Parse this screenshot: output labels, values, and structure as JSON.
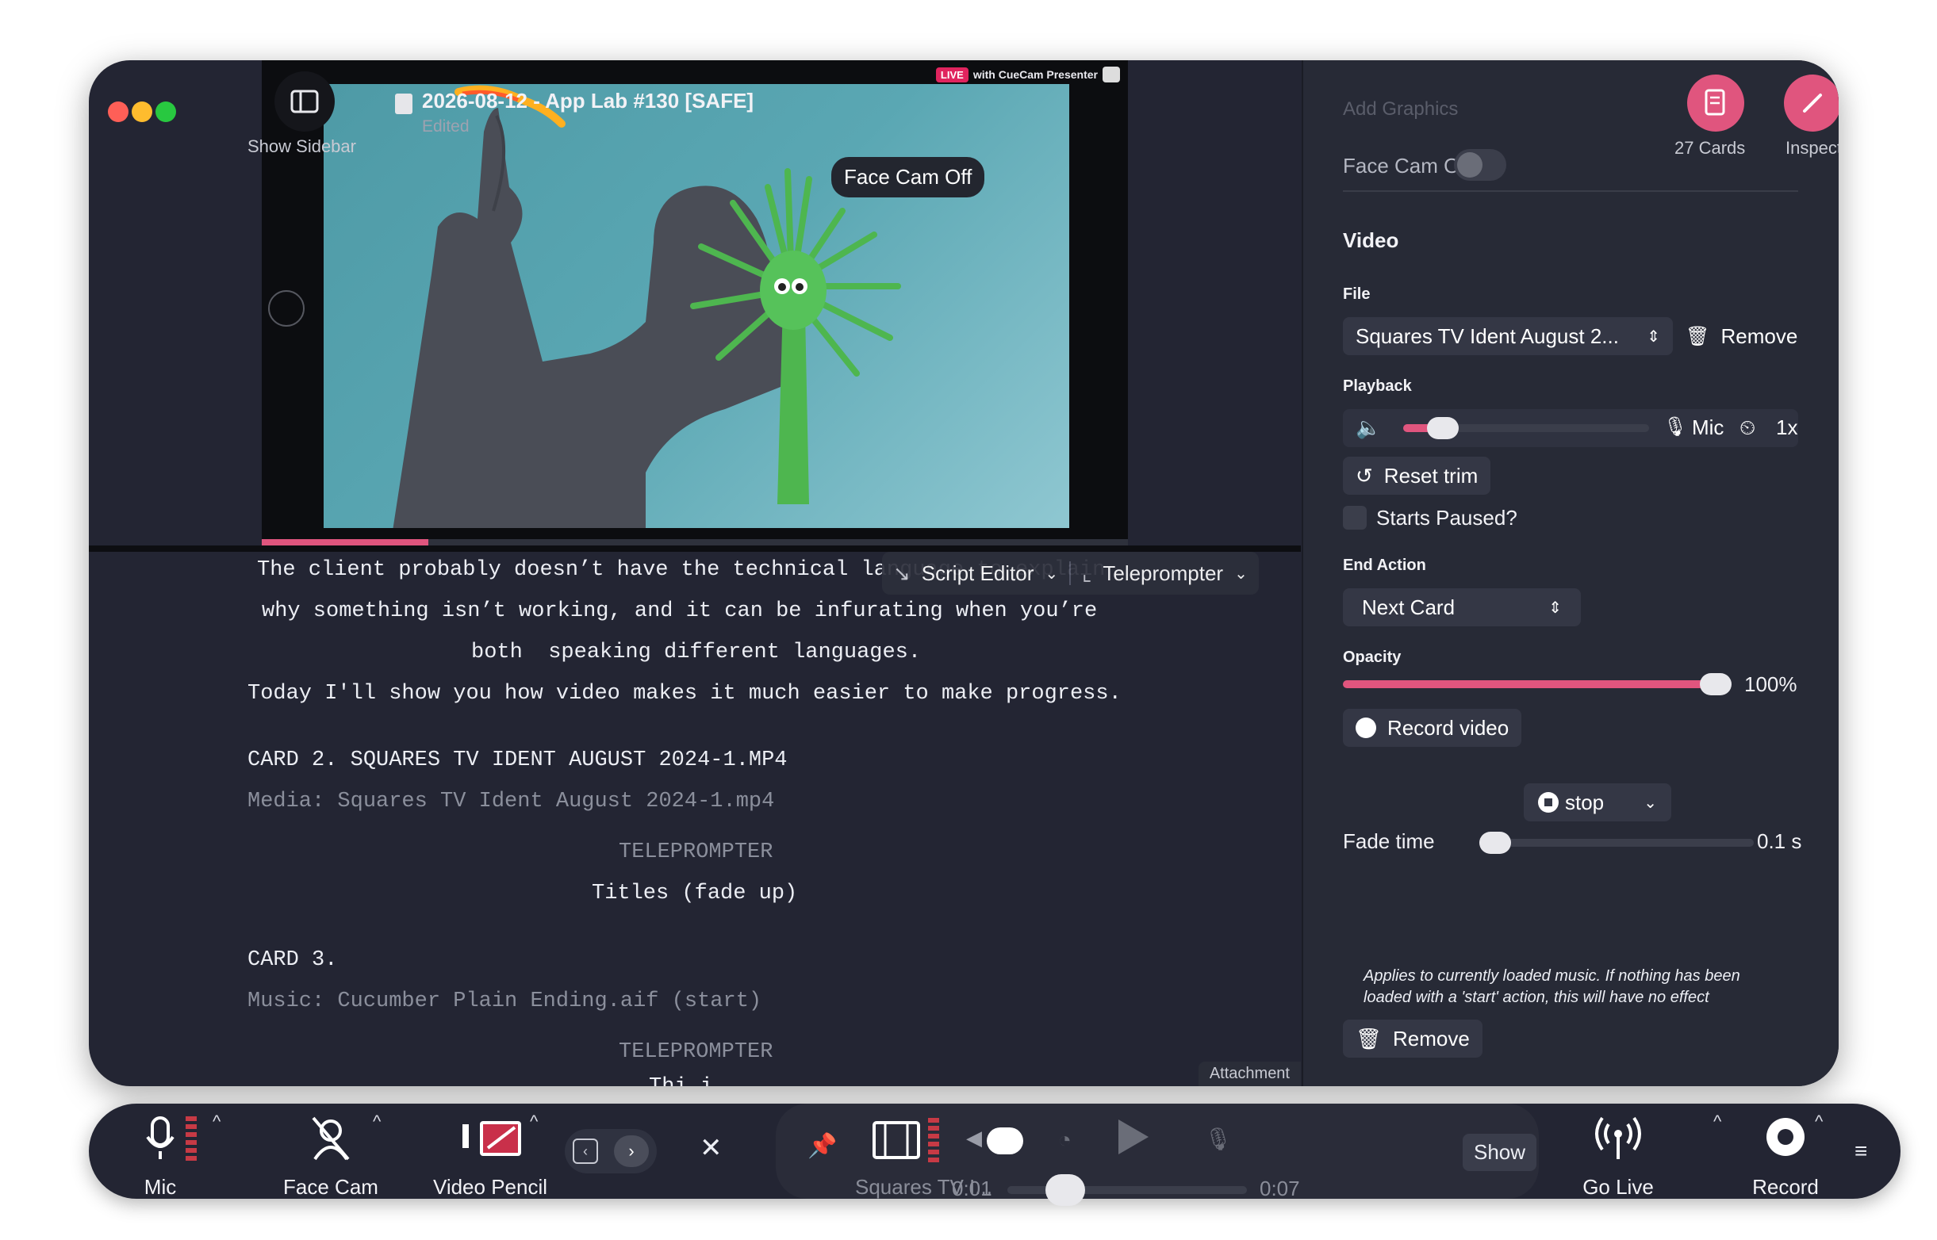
{
  "window": {
    "document_title": "2026-08-12 - App Lab #130 [SAFE]",
    "document_status": "Edited",
    "show_sidebar_label": "Show Sidebar",
    "live_tag": "LIVE",
    "live_text": "with CueCam Presenter"
  },
  "preview": {
    "face_cam_pill": "Face Cam Off",
    "progress_fraction": 0.19
  },
  "script_tabs": {
    "editor": "Script Editor",
    "teleprompter": "Teleprompter"
  },
  "script": {
    "lines": [
      "The client probably doesn’t have the technical language to explain",
      "why something isn’t working, and it can be infurating when you’re",
      "both  speaking different languages.",
      "Today I'll show you how video makes it much easier to make progress."
    ],
    "card2_heading": "CARD 2. SQUARES TV IDENT AUGUST 2024-1.MP4",
    "card2_media": "Media: Squares TV Ident August 2024-1.mp4",
    "card2_teleprompter": "TELEPROMPTER",
    "card2_titles": "Titles (fade up)",
    "card3_heading": "CARD 3.",
    "card3_music": "Music: Cucumber Plain Ending.aif (start)",
    "card3_teleprompter": "TELEPROMPTER",
    "card3_partial": "Thi i",
    "attachment": "Attachment"
  },
  "inspector": {
    "add_graphics": "Add Graphics",
    "face_cam_off": "Face Cam Off",
    "cards_label": "27 Cards",
    "inspect_label": "Inspect",
    "section_video": "Video",
    "file_label": "File",
    "file_value": "Squares TV Ident August 2...",
    "remove_label": "Remove",
    "playback_label": "Playback",
    "mic_label": "Mic",
    "speed_label": "1x",
    "volume_fraction": 0.15,
    "reset_trim": "Reset trim",
    "starts_paused": "Starts Paused?",
    "end_action_label": "End Action",
    "end_action_value": "Next Card",
    "opacity_label": "Opacity",
    "opacity_value": "100%",
    "record_video": "Record video",
    "music_action": "stop",
    "fade_time_label": "Fade time",
    "fade_time_value": "0.1 s",
    "note": "Applies to currently loaded music. If nothing has been loaded with a 'start' action, this will have no effect",
    "remove_bottom": "Remove"
  },
  "toolbar": {
    "mic": "Mic",
    "face_cam": "Face Cam",
    "video_pencil": "Video Pencil",
    "media_name": "Squares TV I...",
    "time_start": "0:01",
    "time_end": "0:07",
    "show": "Show",
    "go_live": "Go Live",
    "record": "Record"
  },
  "colors": {
    "accent": "#e0557e",
    "window_bg": "#232533",
    "panel_bg": "#272a36"
  }
}
